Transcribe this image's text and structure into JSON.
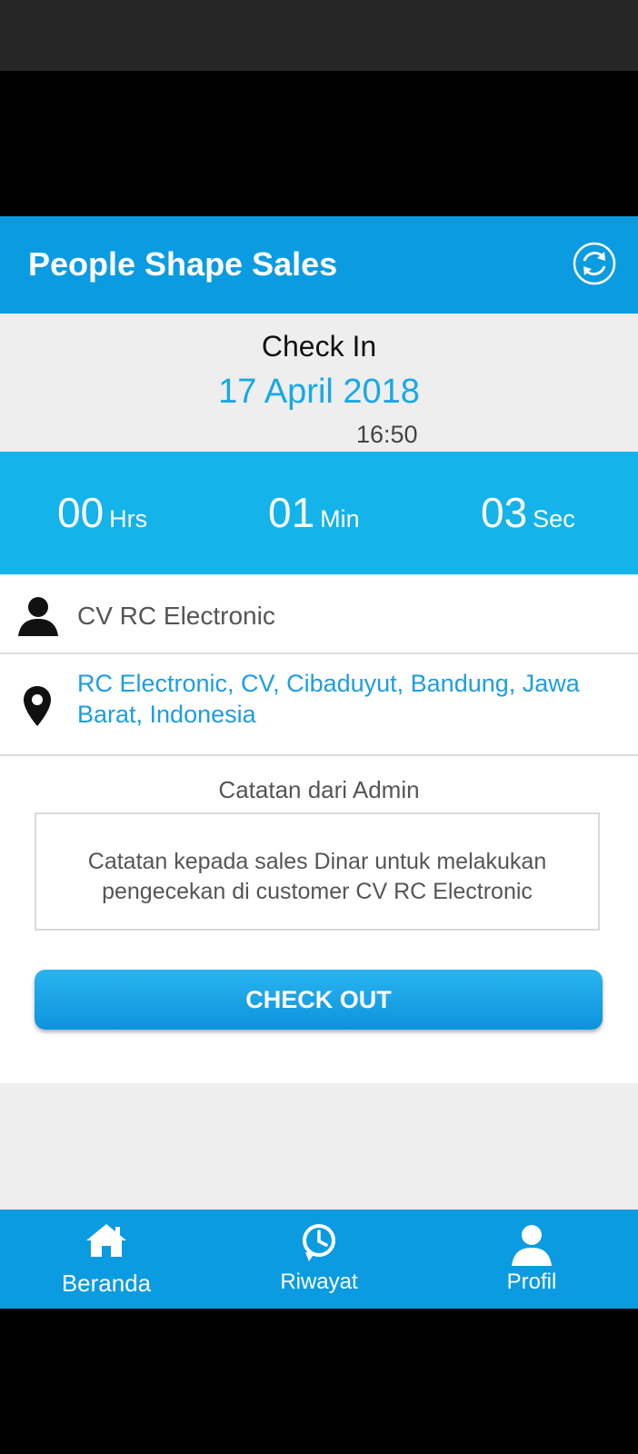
{
  "app": {
    "title": "People Shape Sales",
    "accent_color": "#0b9be0"
  },
  "toolbar": {
    "refresh_icon": "refresh-icon"
  },
  "checkin": {
    "label": "Check In",
    "date": "17 April 2018",
    "time": "16:50"
  },
  "timer": {
    "hours": "00",
    "hours_label": "Hrs",
    "minutes": "01",
    "minutes_label": "Min",
    "seconds": "03",
    "seconds_label": "Sec"
  },
  "customer": {
    "name": "CV RC Electronic",
    "icon": "person-icon"
  },
  "location": {
    "address": "RC Electronic, CV, Cibaduyut, Bandung, Jawa Barat, Indonesia",
    "icon": "location-pin-icon"
  },
  "notes": {
    "title": "Catatan dari Admin",
    "text": "Catatan kepada sales Dinar untuk melakukan pengecekan di customer CV RC Electronic"
  },
  "actions": {
    "checkout_label": "CHECK OUT"
  },
  "bottom_nav": {
    "items": [
      {
        "label": "Beranda",
        "icon": "home-icon"
      },
      {
        "label": "Riwayat",
        "icon": "history-icon"
      },
      {
        "label": "Profil",
        "icon": "profile-icon"
      }
    ]
  }
}
